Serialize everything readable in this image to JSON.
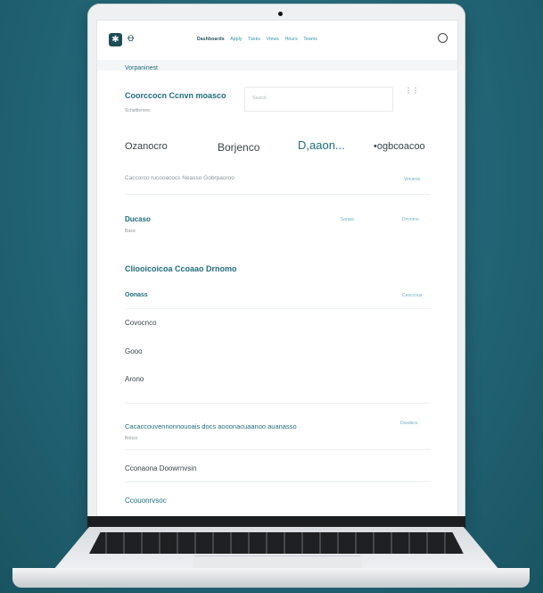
{
  "app": {
    "label": "Ꝋ"
  },
  "nav": {
    "items": [
      "Dashboards",
      "Apply",
      "Tasks",
      "Views",
      "Hours",
      "Teams"
    ]
  },
  "section_title": "Vorpaninest",
  "search": {
    "label": "Coorccocn Ccnvn moasco",
    "placeholder": "Search",
    "hint": "Schuttlenvec"
  },
  "stats": [
    {
      "label": "Ozanocro"
    },
    {
      "label": "Borjenco"
    },
    {
      "label": "D,aaon..."
    },
    {
      "label": "•ogbcoacoo"
    }
  ],
  "stats_caption": "Caccorco rucooacocs Neasso Gobrpaoroo",
  "stats_link": "Vinueno",
  "overview": {
    "title": "Ducaso",
    "subtitle": "Basic",
    "actions": [
      "Sorasc",
      "Docnmo"
    ]
  },
  "group": {
    "title": "Cliooicoicoa Ccoaao Drnomo",
    "header": "Oonass",
    "header_action": "Ceoccnus",
    "items": [
      "Covocnco",
      "Gooo",
      "Arono"
    ]
  },
  "notice": {
    "title": "Cacaccouvennonnouoais docs aooonacuaanoo auanasso",
    "sub": "Bonco",
    "action": "Dosdecs"
  },
  "footer_rows": [
    "Cconaona Doowrnvsin",
    "Ccouonrvsoc"
  ]
}
